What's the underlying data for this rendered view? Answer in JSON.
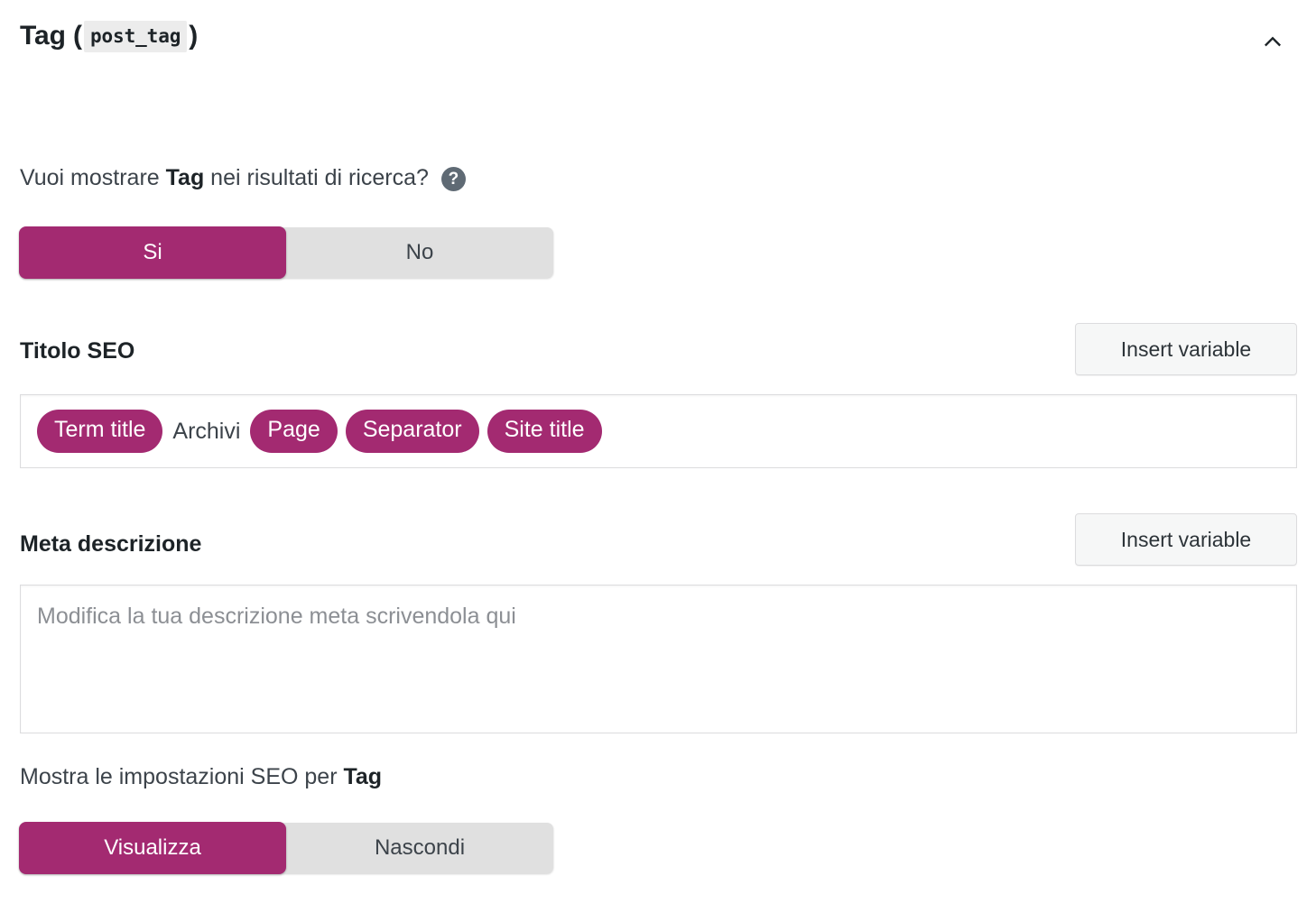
{
  "panel": {
    "title_prefix": "Tag (",
    "title_code": "post_tag",
    "title_suffix": ")",
    "collapse_icon": "chevron-up-icon"
  },
  "search_visibility": {
    "question_prefix": "Vuoi mostrare ",
    "question_strong": "Tag",
    "question_suffix": " nei risultati di ricerca?",
    "help_icon": "?",
    "options": [
      {
        "label": "Si",
        "active": true
      },
      {
        "label": "No",
        "active": false
      }
    ]
  },
  "seo_title": {
    "label": "Titolo SEO",
    "insert_variable_label": "Insert variable",
    "tokens": [
      {
        "type": "token",
        "label": "Term title"
      },
      {
        "type": "text",
        "label": "Archivi"
      },
      {
        "type": "token",
        "label": "Page"
      },
      {
        "type": "token",
        "label": "Separator"
      },
      {
        "type": "token",
        "label": "Site title"
      }
    ]
  },
  "meta_description": {
    "label": "Meta descrizione",
    "insert_variable_label": "Insert variable",
    "value": "",
    "placeholder": "Modifica la tua descrizione meta scrivendola qui"
  },
  "show_settings": {
    "label_prefix": "Mostra le impostazioni SEO per ",
    "label_strong": "Tag",
    "options": [
      {
        "label": "Visualizza",
        "active": true
      },
      {
        "label": "Nascondi",
        "active": false
      }
    ]
  },
  "colors": {
    "accent": "#a32a71",
    "track": "#e0e0e0",
    "border": "#dcdcde",
    "text": "#3c434a",
    "heading": "#1d2327",
    "button_bg": "#f6f7f7",
    "help_bg": "#5f6a74"
  }
}
